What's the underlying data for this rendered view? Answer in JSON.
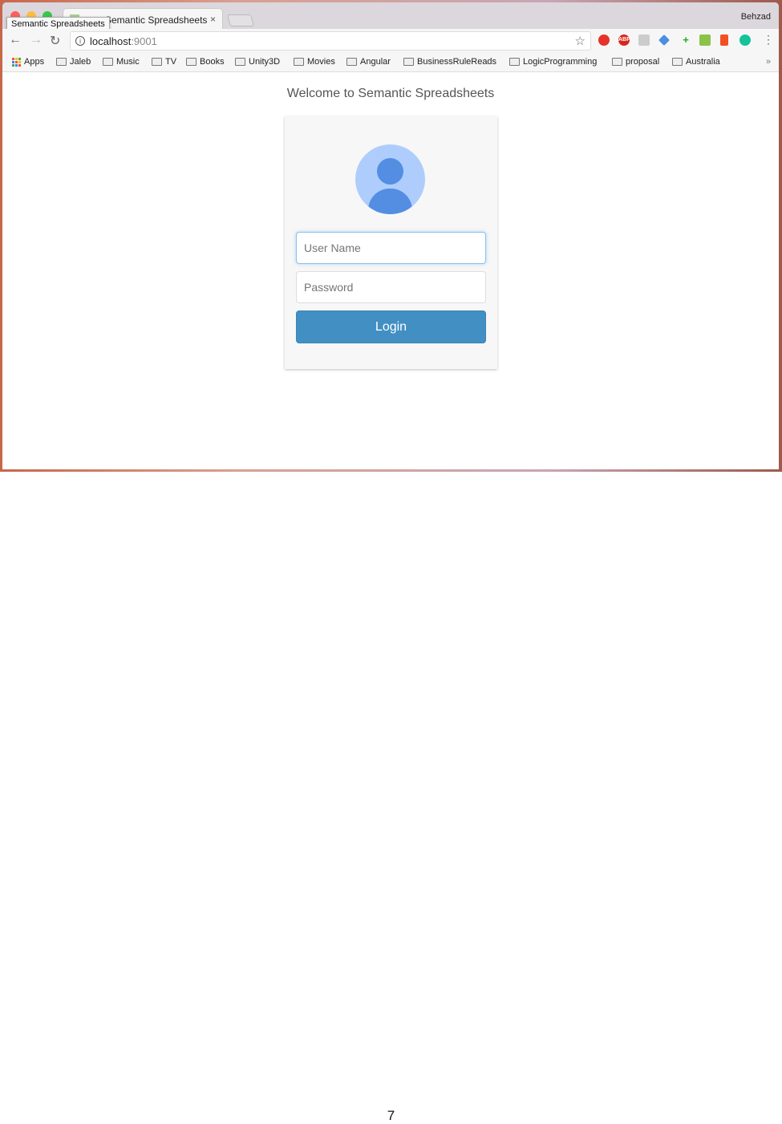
{
  "browser": {
    "tab_title": "Semantic Spreadsheets",
    "tooltip": "Semantic Spreadsheets",
    "tab_close": "×",
    "profile_name": "Behzad",
    "url_host": "localhost",
    "url_port": ":9001",
    "extensions": [
      "opera-icon",
      "adblock-icon",
      "drive-icon",
      "extension-icon",
      "add-icon",
      "print-icon",
      "office-icon",
      "grammarly-icon"
    ],
    "adblock_label": "ABP",
    "bookmarks": [
      "Apps",
      "Jaleb",
      "Music",
      "TV",
      "Books",
      "Unity3D",
      "Movies",
      "Angular",
      "BusinessRuleReads",
      "LogicProgramming",
      "proposal",
      "Australia"
    ],
    "overflow": "»"
  },
  "page": {
    "welcome": "Welcome to Semantic Spreadsheets",
    "username_placeholder": "User Name",
    "password_placeholder": "Password",
    "login_label": "Login"
  },
  "colors": {
    "button": "#428fc4",
    "avatar_bg": "#aecdfd",
    "avatar_fg": "#538ee2"
  },
  "document_page_number": "7"
}
